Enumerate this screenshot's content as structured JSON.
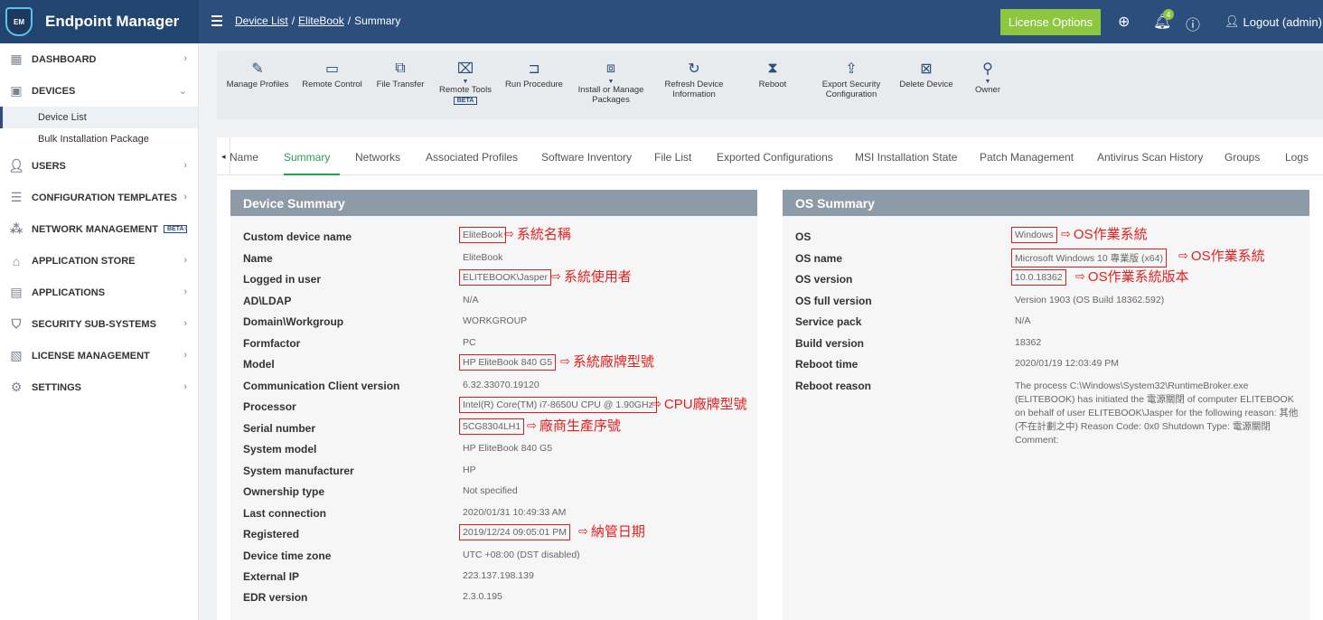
{
  "app": {
    "title": "Endpoint Manager",
    "logo_text": "EM"
  },
  "breadcrumb": {
    "items": [
      "Device List",
      "EliteBook",
      "Summary"
    ],
    "sep": "/"
  },
  "header": {
    "license_label": "License Options",
    "notif_count": "4",
    "logout_label": "Logout (admin)"
  },
  "sidebar": {
    "items": [
      {
        "label": "DASHBOARD"
      },
      {
        "label": "DEVICES"
      },
      {
        "label": "USERS"
      },
      {
        "label": "CONFIGURATION TEMPLATES"
      },
      {
        "label": "NETWORK MANAGEMENT",
        "badge": "BETA"
      },
      {
        "label": "APPLICATION STORE"
      },
      {
        "label": "APPLICATIONS"
      },
      {
        "label": "SECURITY SUB-SYSTEMS"
      },
      {
        "label": "LICENSE MANAGEMENT"
      },
      {
        "label": "SETTINGS"
      }
    ],
    "sub_items": [
      {
        "label": "Device List"
      },
      {
        "label": "Bulk Installation Package"
      }
    ]
  },
  "toolbar": {
    "tools": [
      {
        "label": "Manage Profiles"
      },
      {
        "label": "Remote Control"
      },
      {
        "label": "File Transfer"
      },
      {
        "label": "Remote Tools",
        "badge": "BETA"
      },
      {
        "label": "Run Procedure"
      },
      {
        "label": "Install or Manage Packages"
      },
      {
        "label": "Refresh Device Information"
      },
      {
        "label": "Reboot"
      },
      {
        "label": "Export Security Configuration"
      },
      {
        "label": "Delete Device"
      },
      {
        "label": "Owner"
      }
    ]
  },
  "tabs": [
    "Name",
    "Summary",
    "Networks",
    "Associated Profiles",
    "Software Inventory",
    "File List",
    "Exported Configurations",
    "MSI Installation State",
    "Patch Management",
    "Antivirus Scan History",
    "Groups",
    "Logs"
  ],
  "device_summary": {
    "title": "Device Summary",
    "rows": [
      {
        "label": "Custom device name",
        "value": "EliteBook",
        "note": "系統名稱"
      },
      {
        "label": "Name",
        "value": "EliteBook"
      },
      {
        "label": "Logged in user",
        "value": "ELITEBOOK\\Jasper",
        "note": "系統使用者"
      },
      {
        "label": "AD\\LDAP",
        "value": "N/A"
      },
      {
        "label": "Domain\\Workgroup",
        "value": "WORKGROUP"
      },
      {
        "label": "Formfactor",
        "value": "PC"
      },
      {
        "label": "Model",
        "value": "HP EliteBook 840 G5",
        "note": "系統廠牌型號"
      },
      {
        "label": "Communication Client version",
        "value": "6.32.33070.19120"
      },
      {
        "label": "Processor",
        "value": "Intel(R) Core(TM) i7-8650U CPU @ 1.90GHz",
        "note": "CPU廠牌型號"
      },
      {
        "label": "Serial number",
        "value": "5CG8304LH1",
        "note": "廠商生產序號"
      },
      {
        "label": "System model",
        "value": "HP EliteBook 840 G5"
      },
      {
        "label": "System manufacturer",
        "value": "HP"
      },
      {
        "label": "Ownership type",
        "value": "Not specified"
      },
      {
        "label": "Last connection",
        "value": "2020/01/31 10:49:33 AM"
      },
      {
        "label": "Registered",
        "value": "2019/12/24 09:05:01 PM",
        "note": "納管日期"
      },
      {
        "label": "Device time zone",
        "value": "UTC +08:00 (DST disabled)"
      },
      {
        "label": "External IP",
        "value": "223.137.198.139"
      },
      {
        "label": "EDR version",
        "value": "2.3.0.195"
      }
    ]
  },
  "os_summary": {
    "title": "OS Summary",
    "rows": [
      {
        "label": "OS",
        "value": "Windows",
        "note": "OS作業系統"
      },
      {
        "label": "OS name",
        "value": "Microsoft Windows 10 專業版 (x64)",
        "note": "OS作業系統"
      },
      {
        "label": "OS version",
        "value": "10.0.18362",
        "note": "OS作業系統版本"
      },
      {
        "label": "OS full version",
        "value": "Version 1903 (OS Build 18362.592)"
      },
      {
        "label": "Service pack",
        "value": "N/A"
      },
      {
        "label": "Build version",
        "value": "18362"
      },
      {
        "label": "Reboot time",
        "value": "2020/01/19 12:03:49 PM"
      },
      {
        "label": "Reboot reason",
        "value": "The process C:\\Windows\\System32\\RuntimeBroker.exe (ELITEBOOK) has initiated the 電源關閉 of computer ELITEBOOK on behalf of user ELITEBOOK\\Jasper for the following reason: 其他 (不在計劃之中) Reason Code: 0x0 Shutdown Type: 電源關閉 Comment:"
      }
    ]
  },
  "colors": {
    "header": "#2b4e7c",
    "accent_green": "#8dc63f",
    "tab_active": "#2e9a58",
    "panel_head": "#8d9ba8",
    "annotation": "#e02020"
  }
}
